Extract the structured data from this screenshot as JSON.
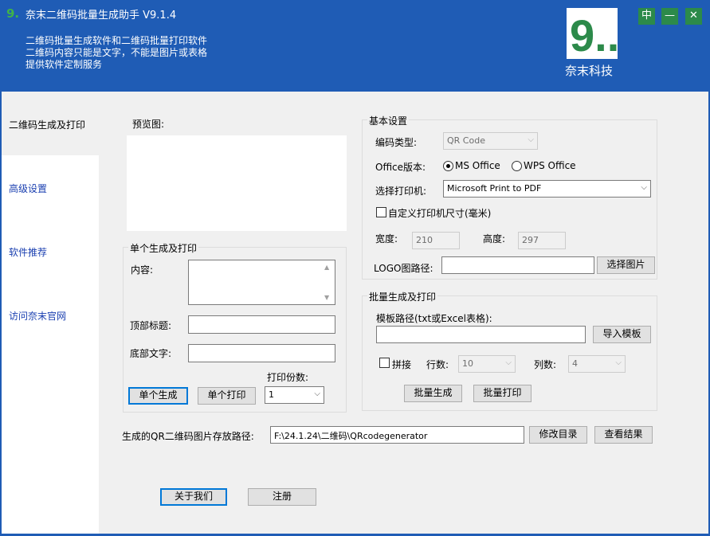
{
  "app": {
    "title": "奈末二维码批量生成助手 V9.1.4",
    "info_lines": [
      "二维码批量生成软件和二维码批量打印软件",
      "二维码内容只能是文字，不能是图片或表格",
      "提供软件定制服务"
    ],
    "logo_glyph": "9...",
    "logo_text": "奈末科技",
    "accent_color": "#1f5cb5",
    "logo_color": "#2c8a4a"
  },
  "window_controls": {
    "pin": "中",
    "minimize": "—",
    "close": "✕"
  },
  "sidebar": {
    "items": [
      {
        "label": "二维码生成及打印"
      },
      {
        "label": "高级设置"
      },
      {
        "label": "软件推荐"
      },
      {
        "label": "访问奈末官网"
      }
    ]
  },
  "preview": {
    "label": "预览图:"
  },
  "single": {
    "group_title": "单个生成及打印",
    "content_label": "内容:",
    "content_value": "",
    "top_title_label": "顶部标题:",
    "top_title_value": "",
    "bottom_text_label": "底部文字:",
    "bottom_text_value": "",
    "copies_label": "打印份数:",
    "copies_value": "1",
    "generate_btn": "单个生成",
    "print_btn": "单个打印"
  },
  "basic": {
    "group_title": "基本设置",
    "encoding_label": "编码类型:",
    "encoding_value": "QR Code",
    "office_label": "Office版本:",
    "office_ms": "MS Office",
    "office_wps": "WPS Office",
    "printer_label": "选择打印机:",
    "printer_value": "Microsoft Print to PDF",
    "custom_size_label": "自定义打印机尺寸(毫米)",
    "width_label": "宽度:",
    "width_value": "210",
    "height_label": "高度:",
    "height_value": "297",
    "logo_label": "LOGO图路径:",
    "logo_value": "",
    "logo_btn": "选择图片"
  },
  "batch": {
    "group_title": "批量生成及打印",
    "template_label": "模板路径(txt或Excel表格):",
    "template_value": "",
    "import_btn": "导入模板",
    "stitch_label": "拼接",
    "rows_label": "行数:",
    "rows_value": "10",
    "cols_label": "列数:",
    "cols_value": "4",
    "generate_btn": "批量生成",
    "print_btn": "批量打印"
  },
  "output": {
    "path_label": "生成的QR二维码图片存放路径:",
    "path_value": "F:\\24.1.24\\二维码\\QRcodegenerator",
    "change_btn": "修改目录",
    "view_btn": "查看结果"
  },
  "footer": {
    "about_btn": "关于我们",
    "register_btn": "注册"
  }
}
